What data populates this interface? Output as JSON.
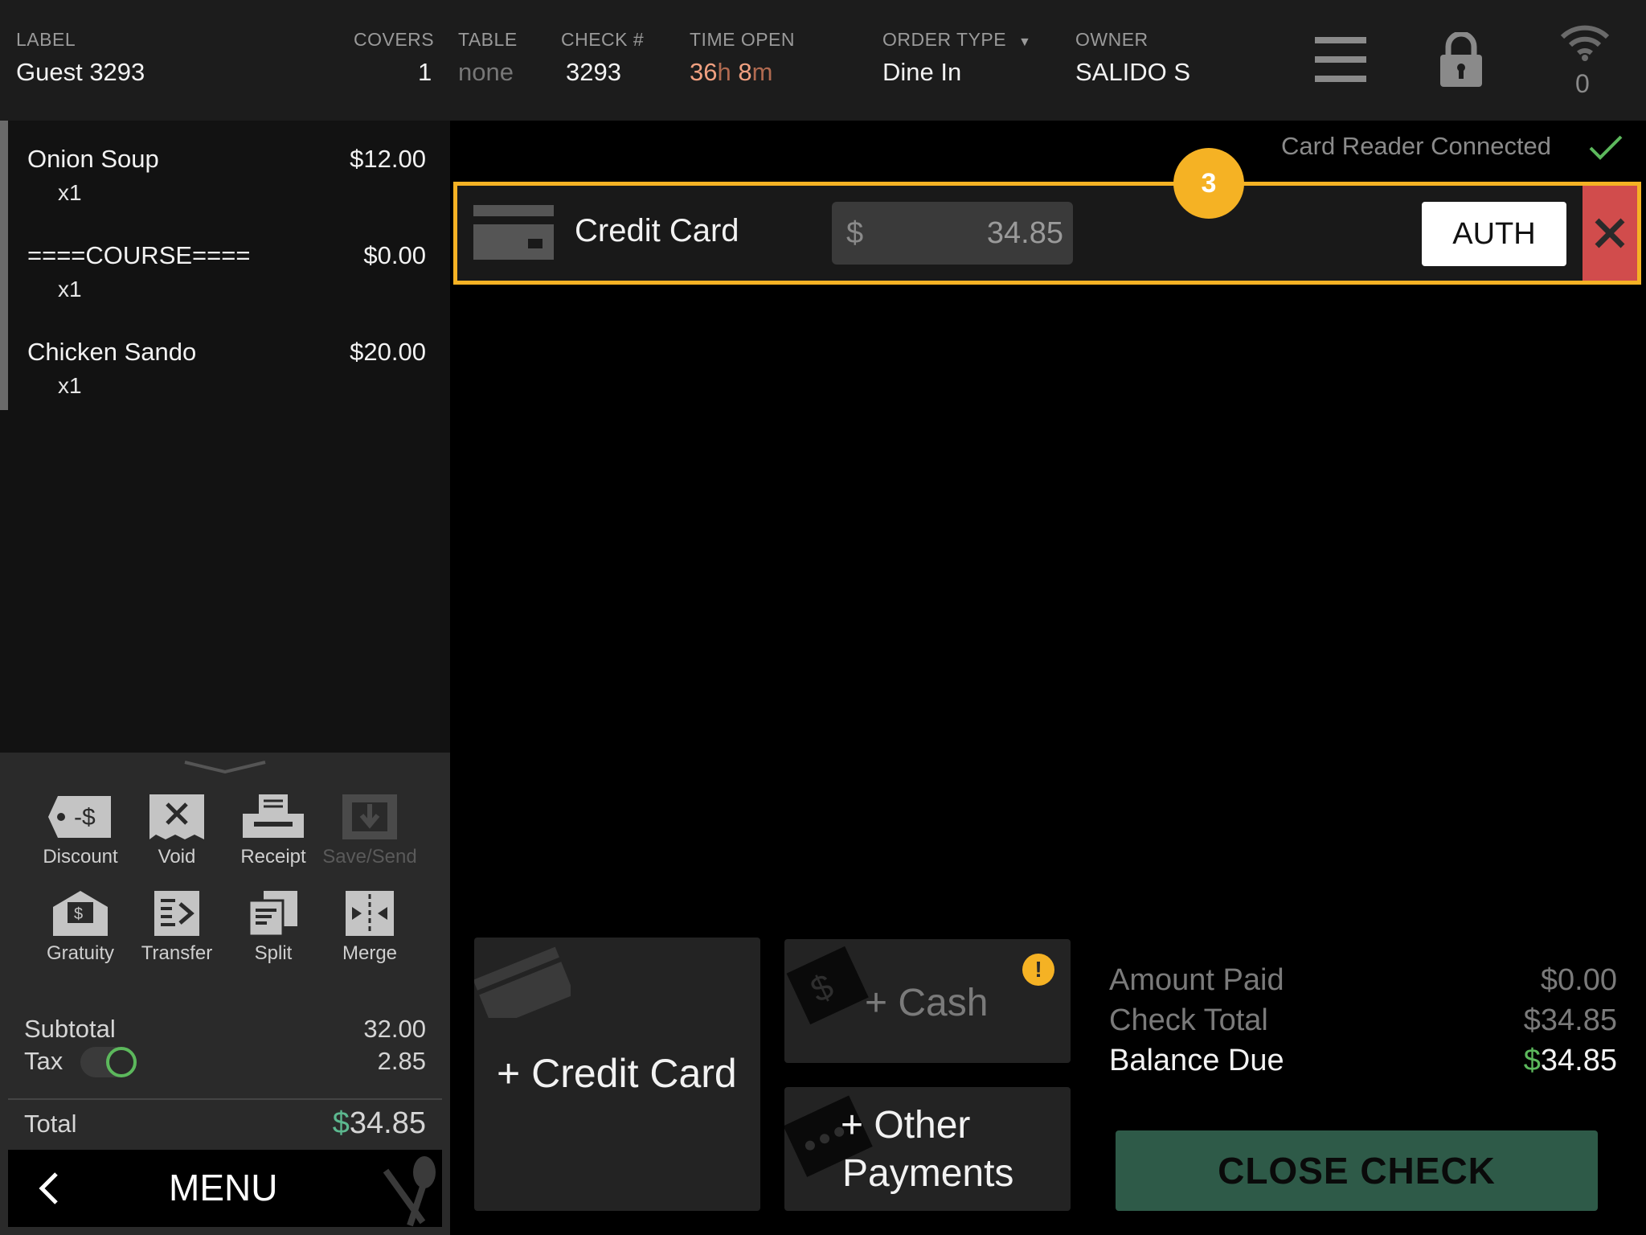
{
  "header": {
    "label": {
      "title": "LABEL",
      "value": "Guest 3293"
    },
    "covers": {
      "title": "COVERS",
      "value": "1"
    },
    "table": {
      "title": "TABLE",
      "value": "none"
    },
    "check": {
      "title": "CHECK #",
      "value": "3293"
    },
    "time_open": {
      "title": "TIME OPEN",
      "hours": "36",
      "h": "h",
      "minutes": "8",
      "m": "m"
    },
    "order_type": {
      "title": "ORDER TYPE",
      "value": "Dine In"
    },
    "owner": {
      "title": "OWNER",
      "value": "SALIDO S"
    },
    "wifi_count": "0",
    "icons": [
      "hamburger-menu-icon",
      "padlock-icon",
      "wifi-icon"
    ]
  },
  "order": {
    "items": [
      {
        "name": "Onion Soup",
        "price": "$12.00",
        "qty": "x1"
      },
      {
        "name": "====COURSE====",
        "price": "$0.00",
        "qty": "x1"
      },
      {
        "name": "Chicken Sando",
        "price": "$20.00",
        "qty": "x1"
      }
    ]
  },
  "actions": [
    {
      "label": "Discount",
      "icon": "discount-tag-icon",
      "enabled": true
    },
    {
      "label": "Void",
      "icon": "void-receipt-icon",
      "enabled": true
    },
    {
      "label": "Receipt",
      "icon": "printer-icon",
      "enabled": true
    },
    {
      "label": "Save/Send",
      "icon": "save-send-icon",
      "enabled": false
    },
    {
      "label": "Gratuity",
      "icon": "gratuity-envelope-icon",
      "enabled": true
    },
    {
      "label": "Transfer",
      "icon": "transfer-icon",
      "enabled": true
    },
    {
      "label": "Split",
      "icon": "split-icon",
      "enabled": true
    },
    {
      "label": "Merge",
      "icon": "merge-icon",
      "enabled": true
    }
  ],
  "totals": {
    "subtotal_label": "Subtotal",
    "subtotal": "32.00",
    "tax_label": "Tax",
    "tax": "2.85",
    "total_label": "Total",
    "total_currency": "$",
    "total": "34.85"
  },
  "menu_button": "MENU",
  "card_reader": {
    "status": "Card Reader Connected"
  },
  "payment_row": {
    "method": "Credit Card",
    "currency": "$",
    "amount": "34.85",
    "auth_label": "AUTH",
    "badge": "3"
  },
  "tiles": {
    "credit_card": "+ Credit Card",
    "cash": "+ Cash",
    "other_line1": "+ Other",
    "other_line2": "Payments"
  },
  "summary": {
    "amount_paid_label": "Amount Paid",
    "amount_paid": "$0.00",
    "check_total_label": "Check Total",
    "check_total": "$34.85",
    "balance_due_label": "Balance Due",
    "balance_currency": "$",
    "balance_due": "34.85"
  },
  "close_check": "CLOSE CHECK",
  "colors": {
    "accent": "#f5b224",
    "danger": "#d14c4c",
    "success": "#5cb85c",
    "time": "#f0a080",
    "close_check_bg": "#2e5a48"
  }
}
